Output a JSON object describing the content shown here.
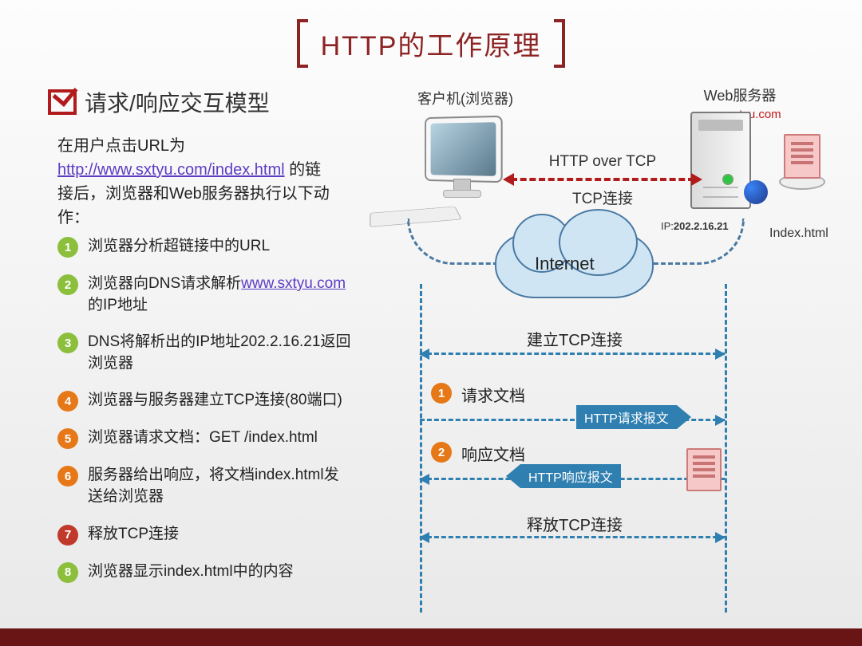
{
  "title": "HTTP的工作原理",
  "subtitle": "请求/响应交互模型",
  "intro": {
    "prefix": "在用户点击URL为",
    "url": "http://www.sxtyu.com/index.html",
    "suffix": "的链接后，浏览器和Web服务器执行以下动作："
  },
  "steps": [
    {
      "n": "1",
      "cls": "bg-green",
      "text": "浏览器分析超链接中的URL"
    },
    {
      "n": "2",
      "cls": "bg-green",
      "text_pre": "浏览器向DNS请求解析",
      "link": "www.sxtyu.com",
      "text_post": "的IP地址"
    },
    {
      "n": "3",
      "cls": "bg-green",
      "text": "DNS将解析出的IP地址202.2.16.21返回浏览器"
    },
    {
      "n": "4",
      "cls": "bg-orange",
      "text": "浏览器与服务器建立TCP连接(80端口)"
    },
    {
      "n": "5",
      "cls": "bg-orange",
      "text": "浏览器请求文档：GET /index.html"
    },
    {
      "n": "6",
      "cls": "bg-orange",
      "text": "服务器给出响应，将文档index.html发送给浏览器"
    },
    {
      "n": "7",
      "cls": "bg-red",
      "text": "释放TCP连接"
    },
    {
      "n": "8",
      "cls": "bg-green",
      "text": "浏览器显示index.html中的内容"
    }
  ],
  "diagram": {
    "client_label": "客户机(浏览器)",
    "server_label": "Web服务器",
    "server_url": "www.sxtyu.com",
    "conn1": "HTTP over TCP",
    "conn2": "TCP连接",
    "ip_label": "IP:202.2.16.21",
    "file_label": "Index.html",
    "internet": "Internet",
    "seq": {
      "establish": "建立TCP连接",
      "req": "请求文档",
      "req_tag": "HTTP请求报文",
      "res": "响应文档",
      "res_tag": "HTTP响应报文",
      "release": "释放TCP连接"
    }
  }
}
